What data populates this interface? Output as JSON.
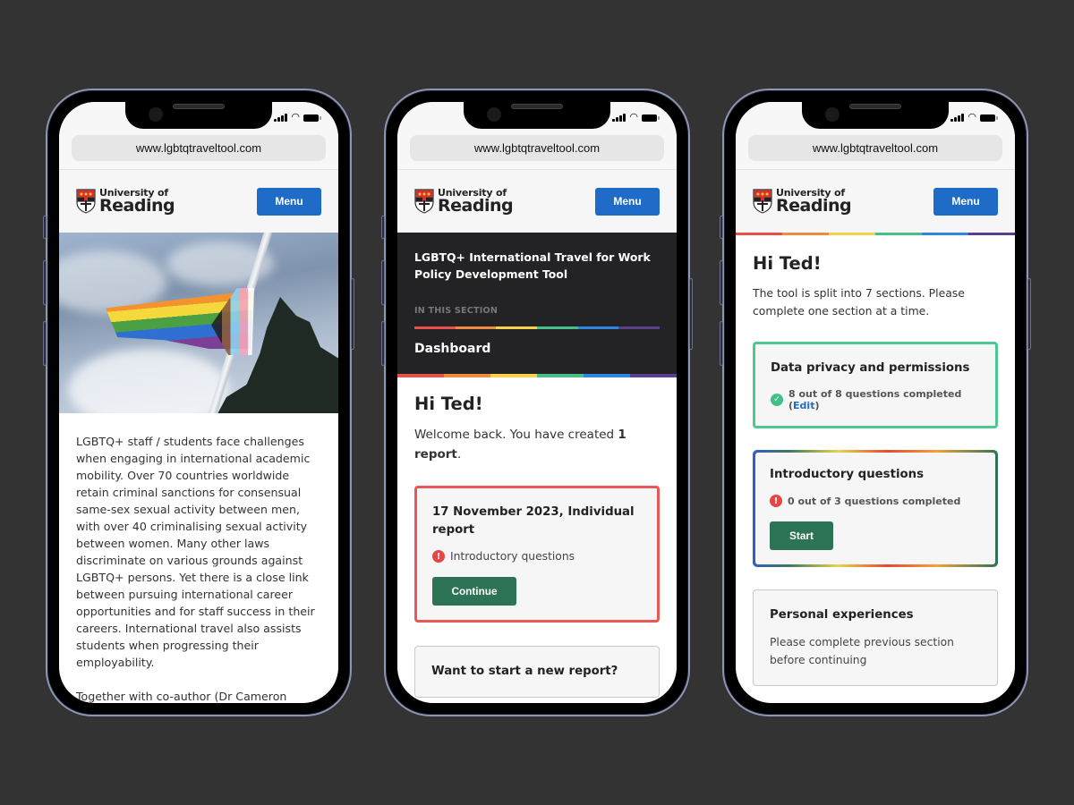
{
  "browser": {
    "url": "www.lgbtqtraveltool.com"
  },
  "header": {
    "logo_small": "University of",
    "logo_big": "Reading",
    "menu_label": "Menu"
  },
  "rainbow_colors": [
    "#e8504a",
    "#f08a3e",
    "#f5d24a",
    "#45c08a",
    "#2f86e0",
    "#5b3f8c"
  ],
  "phone1": {
    "hero_image_alt": "Progress pride flag on flagpole",
    "paragraphs": [
      "LGBTQ+ staff / students face challenges when engaging in international academic mobility. Over 70 countries worldwide retain criminal sanctions for consensual same-sex sexual activity between men, with over 40 criminalising sexual activity between women. Many other laws discriminate on various grounds against LGBTQ+ persons. Yet there is a close link between pursuing international career opportunities and for staff success in their careers. International travel also assists students when progressing their employability.",
      "Together with co-author (Dr Cameron Giles, Lecturer, South Bank University) lead"
    ]
  },
  "phone2": {
    "tool_title": "LGBTQ+ International Travel for Work Policy Development Tool",
    "section_label": "IN THIS SECTION",
    "nav_current": "Dashboard",
    "greeting": "Hi Ted!",
    "welcome_prefix": "Welcome back. You have created ",
    "welcome_bold": "1 report",
    "welcome_suffix": ".",
    "report_card": {
      "title": "17 November 2023, Individual report",
      "status": "Introductory questions",
      "button": "Continue"
    },
    "new_report_card": {
      "title": "Want to start a new report?"
    }
  },
  "phone3": {
    "greeting": "Hi Ted!",
    "intro": "The tool is split into 7 sections. Please complete one section at a time.",
    "sections": [
      {
        "title": "Data privacy and permissions",
        "status": "8 out of 8 questions completed (",
        "link": "Edit",
        "status_end": ")",
        "state": "complete",
        "completed": 8,
        "total": 8
      },
      {
        "title": "Introductory questions",
        "status": "0 out of 3 questions completed",
        "button": "Start",
        "state": "current",
        "completed": 0,
        "total": 3
      },
      {
        "title": "Personal experiences",
        "description": "Please complete previous section before continuing",
        "state": "locked"
      }
    ]
  },
  "icons": {
    "alert": "!",
    "check": "✓",
    "wifi": "wifi-icon",
    "signal": "signal-icon",
    "battery": "battery-icon"
  }
}
